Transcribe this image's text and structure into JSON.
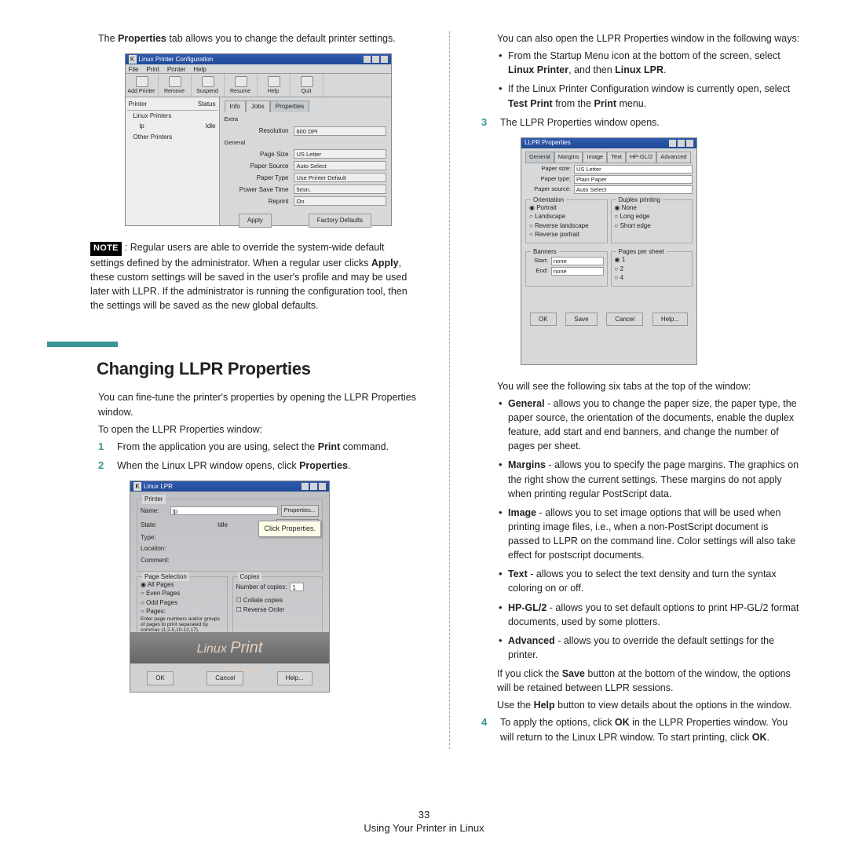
{
  "left": {
    "intro_1a": "The ",
    "intro_1b": "Properties",
    "intro_1c": " tab allows you to change the default printer settings.",
    "note_label": "NOTE",
    "note_1": ": Regular users are able to override the system-wide default settings defined by the administrator. When a regular user clicks ",
    "note_2": "Apply",
    "note_3": ", these custom settings will be saved in the user's profile and may be used later with LLPR. If the administrator is running the configuration tool, then the settings will be saved as the new global defaults.",
    "heading": "Changing LLPR Properties",
    "p2": "You can fine-tune the printer's properties by opening the LLPR Properties window.",
    "p3": "To open the LLPR Properties window:",
    "step1a": "From the application you are using, select the ",
    "step1b": "Print",
    "step1c": " command.",
    "step2a": "When the Linux LPR window opens, click ",
    "step2b": "Properties",
    "step2c": ".",
    "callout": "Click Properties."
  },
  "fig1": {
    "title": "Linux Printer Configuration",
    "menus": [
      "File",
      "Print",
      "Printer",
      "Help"
    ],
    "buttons": [
      "Add Printer",
      "Remove",
      "Suspend",
      "Resume",
      "Help",
      "Quit"
    ],
    "tree_hdr_a": "Printer",
    "tree_hdr_b": "Status",
    "tree_root": "Linux Printers",
    "tree_item": "lp",
    "tree_status": "Idle",
    "tree_other": "Other Printers",
    "tabs": [
      "Info",
      "Jobs",
      "Properties"
    ],
    "sect": "Extra",
    "sect2": "General",
    "f_res_l": "Resolution",
    "f_res_v": "600 DPI",
    "f_psize_l": "Page Size",
    "f_psize_v": "US Letter",
    "f_psrc_l": "Paper Source",
    "f_psrc_v": "Auto Select",
    "f_ptype_l": "Paper Type",
    "f_ptype_v": "Use Printer Default",
    "f_pst_l": "Power Save Time",
    "f_pst_v": "5min.",
    "f_rep_l": "Reprint",
    "f_rep_v": "On",
    "apply": "Apply",
    "fdef": "Factory Defaults"
  },
  "fig2": {
    "title": "Linux LPR",
    "sect_printer": "Printer",
    "name_l": "Name:",
    "name_v": "lp",
    "state_l": "State:",
    "state_v": "Idle",
    "type_l": "Type:",
    "loc_l": "Location:",
    "com_l": "Comment:",
    "props_btn": "Properties...",
    "def_btn": "Set as default",
    "sect_ps": "Page Selection",
    "r_all": "All Pages",
    "r_even": "Even Pages",
    "r_odd": "Odd Pages",
    "r_pages": "Pages:",
    "pages_hint": "Enter page numbers and/or groups of pages to print separated by commas (1,2-5,10-12,17).",
    "sect_copies": "Copies",
    "nc_l": "Number of copies:",
    "nc_v": "1",
    "collate": "Collate copies",
    "reverse": "Reverse Order",
    "logo_a": "Linux ",
    "logo_b": "Print",
    "logo_c": "Package",
    "b_ok": "OK",
    "b_cancel": "Cancel",
    "b_help": "Help..."
  },
  "fig3": {
    "title": "LLPR Properties",
    "tabs": [
      "General",
      "Margins",
      "Image",
      "Text",
      "HP-GL/2",
      "Advanced"
    ],
    "psize_l": "Paper size:",
    "psize_v": "US Letter",
    "ptype_l": "Paper type:",
    "ptype_v": "Plain Paper",
    "psrc_l": "Paper source:",
    "psrc_v": "Auto Select",
    "orient": "Orientation",
    "o_portrait": "Portrait",
    "o_landscape": "Landscape",
    "o_revl": "Reverse landscape",
    "o_revp": "Reverse portrait",
    "duplex": "Duplex printing",
    "d_none": "None",
    "d_long": "Long edge",
    "d_short": "Short edge",
    "banners": "Banners",
    "b_start_l": "Start:",
    "b_end_l": "End:",
    "b_none": "none",
    "pps": "Pages per sheet",
    "pps_1": "1",
    "pps_2": "2",
    "pps_4": "4",
    "b_ok": "OK",
    "b_save": "Save",
    "b_cancel": "Cancel",
    "b_help": "Help..."
  },
  "right": {
    "p1": "You can also open the LLPR Properties window in the following ways:",
    "b1a": "From the Startup Menu icon at the bottom of the screen, select ",
    "b1b": "Linux Printer",
    "b1c": ", and then ",
    "b1d": "Linux LPR",
    "b1e": ".",
    "b2a": "If the Linux Printer Configuration window is currently open, select ",
    "b2b": "Test Print",
    "b2c": " from the ",
    "b2d": "Print",
    "b2e": " menu.",
    "s3": "The LLPR Properties window opens.",
    "p2": "You will see the following six tabs at the top of the window:",
    "t_gen_a": "General",
    "t_gen_b": " - allows you to change the paper size, the paper type, the paper source, the orientation of the documents, enable the duplex feature, add start and end banners, and change the number of pages per sheet.",
    "t_mar_a": "Margins",
    "t_mar_b": " - allows you to specify the page margins. The graphics on the right show the current settings. These margins do not apply when printing regular PostScript data.",
    "t_img_a": "Image",
    "t_img_b": " - allows you to set image options that will be used when printing image files, i.e., when a non-PostScript document is passed to LLPR on the command line. Color settings will also take effect for postscript documents.",
    "t_txt_a": "Text",
    "t_txt_b": " - allows you to select the text density and turn the syntax coloring on or off.",
    "t_hp_a": "HP-GL/2",
    "t_hp_b": " - allows you to set default options to print HP-GL/2 format documents, used by some plotters.",
    "t_adv_a": "Advanced",
    "t_adv_b": " - allows you to override the default settings for the printer.",
    "p3a": "If you click the ",
    "p3b": "Save",
    "p3c": " button at the bottom of the window, the options will be retained between LLPR sessions.",
    "p4a": "Use the ",
    "p4b": "Help",
    "p4c": " button to view details about the options in the window.",
    "s4a": "To apply the options, click ",
    "s4b": "OK",
    "s4c": " in the LLPR Properties window. You will return to the Linux LPR window. To start printing, click ",
    "s4d": "OK",
    "s4e": "."
  },
  "footer": {
    "page": "33",
    "caption": "Using Your Printer in Linux"
  }
}
